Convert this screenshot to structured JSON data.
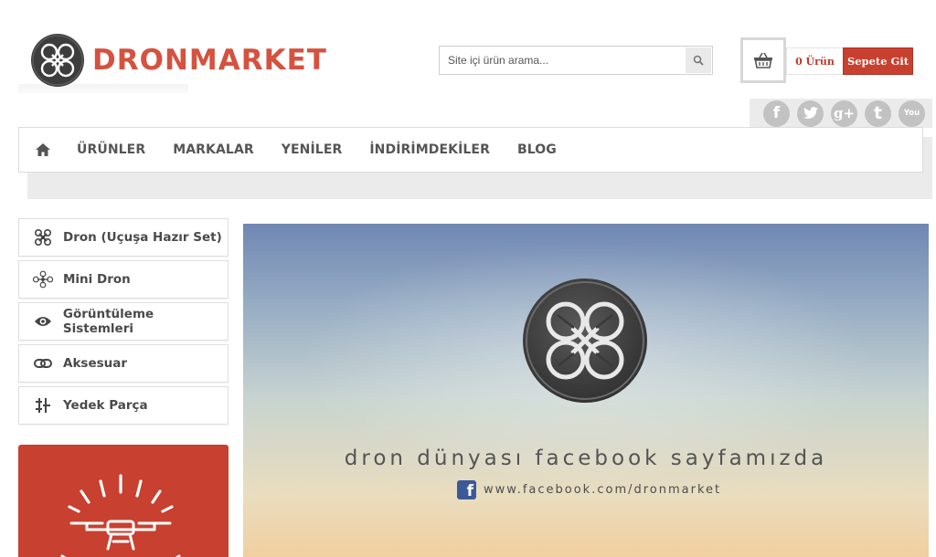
{
  "header": {
    "logo_text": "DRONMARKET",
    "logo_icon": "drone-logo-icon",
    "brand_color": "#d4523f"
  },
  "search": {
    "placeholder": "Site içi ürün arama...",
    "value": "",
    "icon": "search-icon"
  },
  "cart": {
    "icon": "basket-icon",
    "count_label": "0 Ürün",
    "go_label": "Sepete Git",
    "accent": "#c8402f"
  },
  "social": {
    "icons": [
      "facebook-icon",
      "twitter-icon",
      "google-plus-icon",
      "tumblr-icon",
      "youtube-icon"
    ],
    "glyphs": [
      "f",
      "t",
      "g+",
      "t",
      "You"
    ]
  },
  "nav": {
    "home_icon": "home-icon",
    "items": [
      {
        "label": "ÜRÜNLER"
      },
      {
        "label": "MARKALAR"
      },
      {
        "label": "YENİLER"
      },
      {
        "label": "İNDİRİMDEKİLER"
      },
      {
        "label": "BLOG"
      }
    ]
  },
  "sidebar": {
    "categories": [
      {
        "label": "Dron (Uçuşa Hazır Set)",
        "icon": "drone-icon"
      },
      {
        "label": "Mini Dron",
        "icon": "mini-drone-icon"
      },
      {
        "label": "Görüntüleme Sistemleri",
        "icon": "eye-icon"
      },
      {
        "label": "Aksesuar",
        "icon": "link-icon"
      },
      {
        "label": "Yedek Parça",
        "icon": "parts-icon"
      }
    ],
    "promo_color": "#c8402f"
  },
  "banner": {
    "headline": "dron dünyası facebook sayfamızda",
    "url": "www.facebook.com/dronmarket",
    "fb_icon": "facebook-square-icon"
  }
}
